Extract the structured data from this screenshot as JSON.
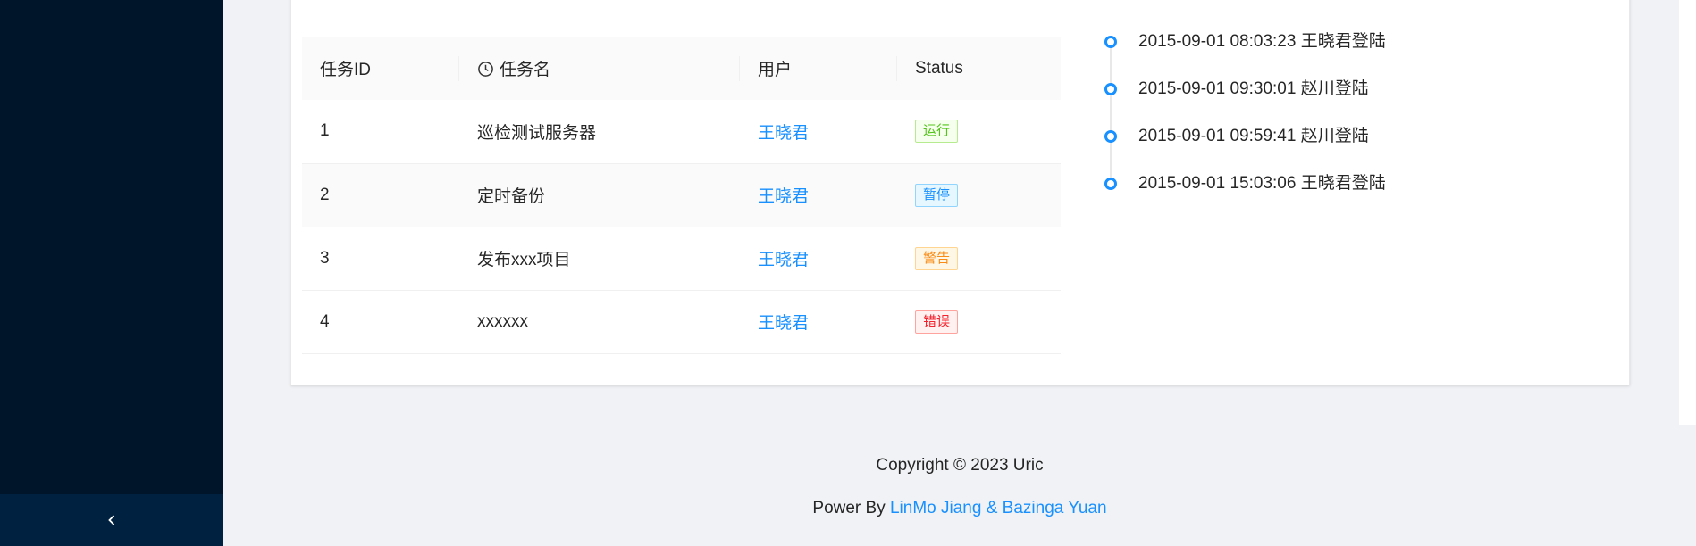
{
  "table": {
    "columns": [
      "任务ID",
      "任务名",
      "用户",
      "Status"
    ],
    "rows": [
      {
        "id": "1",
        "name": "巡检测试服务器",
        "user": "王晓君",
        "status": "运行"
      },
      {
        "id": "2",
        "name": "定时备份",
        "user": "王晓君",
        "status": "暂停"
      },
      {
        "id": "3",
        "name": "发布xxx项目",
        "user": "王晓君",
        "status": "警告"
      },
      {
        "id": "4",
        "name": "xxxxxx",
        "user": "王晓君",
        "status": "错误"
      }
    ]
  },
  "timeline": {
    "items": [
      "2015-09-01 08:03:23 王晓君登陆",
      "2015-09-01 09:30:01 赵川登陆",
      "2015-09-01 09:59:41 赵川登陆",
      "2015-09-01 15:03:06 王晓君登陆"
    ]
  },
  "footer": {
    "copyright": "Copyright © 2023 Uric",
    "power_prefix": "Power By ",
    "power_link": "LinMo Jiang & Bazinga Yuan"
  },
  "colors": {
    "sider": "#001529",
    "sider_trigger": "#002140",
    "link": "#1890ff",
    "status_running": "#52c41a",
    "status_paused": "#1890ff",
    "status_warning": "#fa8c16",
    "status_error": "#f5222d"
  },
  "icons": {
    "collapse": "chevron-left-icon",
    "task_name_column": "clock-icon",
    "timeline": "circle-dot-icon"
  }
}
